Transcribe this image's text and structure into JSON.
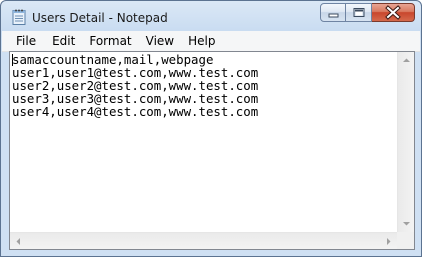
{
  "window": {
    "title": "Users Detail - Notepad",
    "app_icon": "notepad-icon"
  },
  "caption_buttons": [
    "minimize-icon",
    "maximize-icon",
    "close-icon"
  ],
  "menu": {
    "items": [
      {
        "label": "File"
      },
      {
        "label": "Edit"
      },
      {
        "label": "Format"
      },
      {
        "label": "View"
      },
      {
        "label": "Help"
      }
    ]
  },
  "document": {
    "lines": [
      "samaccountname,mail,webpage",
      "user1,user1@test.com,www.test.com",
      "user2,user2@test.com,www.test.com",
      "user3,user3@test.com,www.test.com",
      "user4,user4@test.com,www.test.com"
    ]
  },
  "colors": {
    "frame": "#cfe0f3",
    "close_button": "#c8462c",
    "menubar": "#f5f6f7"
  }
}
